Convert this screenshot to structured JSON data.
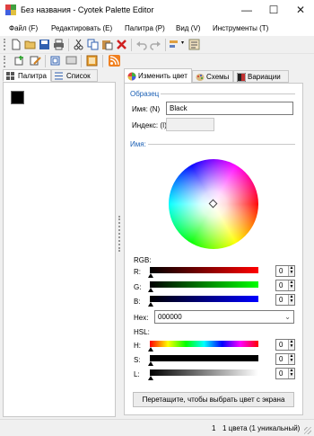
{
  "window": {
    "title": "Без названия - Cyotek Palette Editor",
    "minimize_glyph": "—",
    "maximize_glyph": "☐",
    "close_glyph": "✕"
  },
  "menu": {
    "items": [
      "Файл (F)",
      "Редактировать (E)",
      "Палитра (P)",
      "Вид (V)",
      "Инструменты (T)"
    ]
  },
  "toolbar": {
    "icons": [
      "new-file-icon",
      "open-folder-icon",
      "save-icon",
      "print-icon",
      "cut-icon",
      "copy-icon",
      "paste-icon",
      "delete-icon",
      "undo-icon",
      "redo-icon",
      "sort-icon",
      "dropdown-icon",
      "properties-icon"
    ]
  },
  "left_panel": {
    "tabs": [
      "Палитра",
      "Список"
    ],
    "swatch_color": "#000000"
  },
  "right_panel": {
    "tabs": [
      "Изменить цвет",
      "Схемы",
      "Вариации"
    ],
    "sample_header": "Образец",
    "name_label": "Имя: (N)",
    "name_value": "Black",
    "index_label": "Индекс: (I)",
    "index_value": "",
    "wheel_header": "Имя:",
    "rgb_header": "RGB:",
    "r_label": "R:",
    "r_value": "0",
    "g_label": "G:",
    "g_value": "0",
    "b_label": "B:",
    "b_value": "0",
    "hex_label": "Hex:",
    "hex_value": "000000",
    "hsl_header": "HSL:",
    "h_label": "H:",
    "h_value": "0",
    "s_label": "S:",
    "s_value": "0",
    "l_label": "L:",
    "l_value": "0",
    "pick_button": "Перетащите, чтобы выбрать цвет с экрана"
  },
  "status": {
    "count": "1",
    "summary": "1 цвета (1 уникальный)"
  },
  "colors": {
    "accent": "#1a5fb4",
    "selection_black": "#000000"
  }
}
